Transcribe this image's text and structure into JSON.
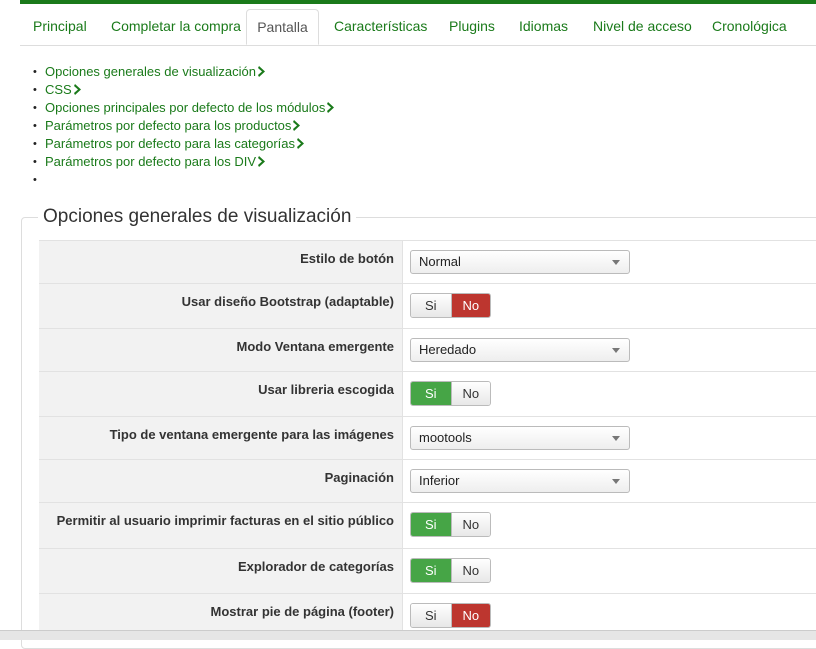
{
  "tabs": [
    {
      "label": "Principal"
    },
    {
      "label": "Completar la compra"
    },
    {
      "label": "Pantalla"
    },
    {
      "label": "Características"
    },
    {
      "label": "Plugins"
    },
    {
      "label": "Idiomas"
    },
    {
      "label": "Nivel de acceso"
    },
    {
      "label": "Cronológica"
    }
  ],
  "active_tab": "Pantalla",
  "links": [
    {
      "label": "Opciones generales de visualización"
    },
    {
      "label": "CSS"
    },
    {
      "label": "Opciones principales por defecto de los módulos"
    },
    {
      "label": "Parámetros por defecto para los productos"
    },
    {
      "label": "Parámetros por defecto para las categorías"
    },
    {
      "label": "Parámetros por defecto para los DIV"
    },
    {
      "label": ""
    }
  ],
  "bullet": "•",
  "section": {
    "legend": "Opciones generales de visualización",
    "rows": [
      {
        "label": "Estilo de botón",
        "control": "select",
        "value": "Normal"
      },
      {
        "label": "Usar diseño Bootstrap (adaptable)",
        "control": "toggle",
        "yes": "Si",
        "no": "No",
        "selected": "no"
      },
      {
        "label": "Modo Ventana emergente",
        "control": "select",
        "value": "Heredado"
      },
      {
        "label": "Usar libreria escogida",
        "control": "toggle",
        "yes": "Si",
        "no": "No",
        "selected": "yes"
      },
      {
        "label": "Tipo de ventana emergente para las imágenes",
        "control": "select",
        "value": "mootools"
      },
      {
        "label": "Paginación",
        "control": "select",
        "value": "Inferior"
      },
      {
        "label": "Permitir al usuario imprimir facturas en el sitio público",
        "control": "toggle",
        "yes": "Si",
        "no": "No",
        "selected": "yes"
      },
      {
        "label": "Explorador de categorías",
        "control": "toggle",
        "yes": "Si",
        "no": "No",
        "selected": "yes"
      },
      {
        "label": "Mostrar pie de página (footer)",
        "control": "toggle",
        "yes": "Si",
        "no": "No",
        "selected": "no"
      }
    ]
  },
  "colors": {
    "accent_green": "#1a7a1a",
    "yes_green": "#46a546",
    "no_red": "#bd362f"
  }
}
